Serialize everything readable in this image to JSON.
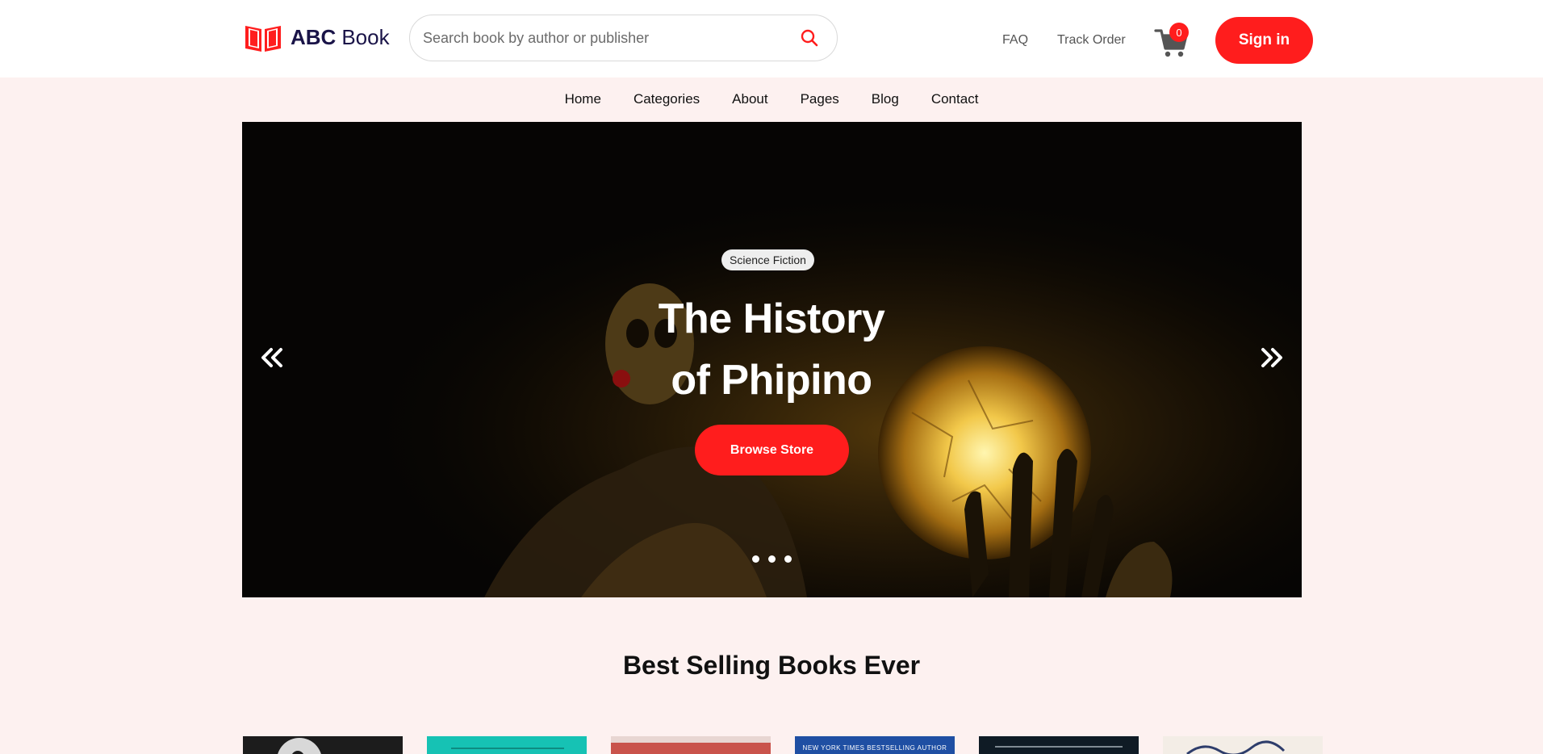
{
  "header": {
    "brand_strong": "ABC",
    "brand_light": "Book",
    "search_placeholder": "Search book by author or publisher",
    "links": {
      "faq": "FAQ",
      "track_order": "Track Order"
    },
    "cart_count": "0",
    "signin_label": "Sign in"
  },
  "nav": {
    "items": [
      "Home",
      "Categories",
      "About",
      "Pages",
      "Blog",
      "Contact"
    ]
  },
  "hero": {
    "badge": "Science Fiction",
    "title_line1": "The History",
    "title_line2": "of Phipino",
    "cta": "Browse Store",
    "slides": 3
  },
  "best_selling": {
    "title": "Best Selling Books Ever",
    "books": [
      {
        "cover_color": "#1c1c1c",
        "cover_text": ""
      },
      {
        "cover_color": "#16c2b4",
        "cover_text": ""
      },
      {
        "cover_color": "#c9534b",
        "cover_text": ""
      },
      {
        "cover_color": "#1f4fa3",
        "cover_text": "NEW YORK TIMES BESTSELLING AUTHOR"
      },
      {
        "cover_color": "#0f1b25",
        "cover_text": ""
      },
      {
        "cover_color": "#f3ede6",
        "cover_text": ""
      }
    ]
  },
  "colors": {
    "accent": "#ff1d1d",
    "brand": "#1a1448",
    "page_bg": "#fdf1f0"
  }
}
